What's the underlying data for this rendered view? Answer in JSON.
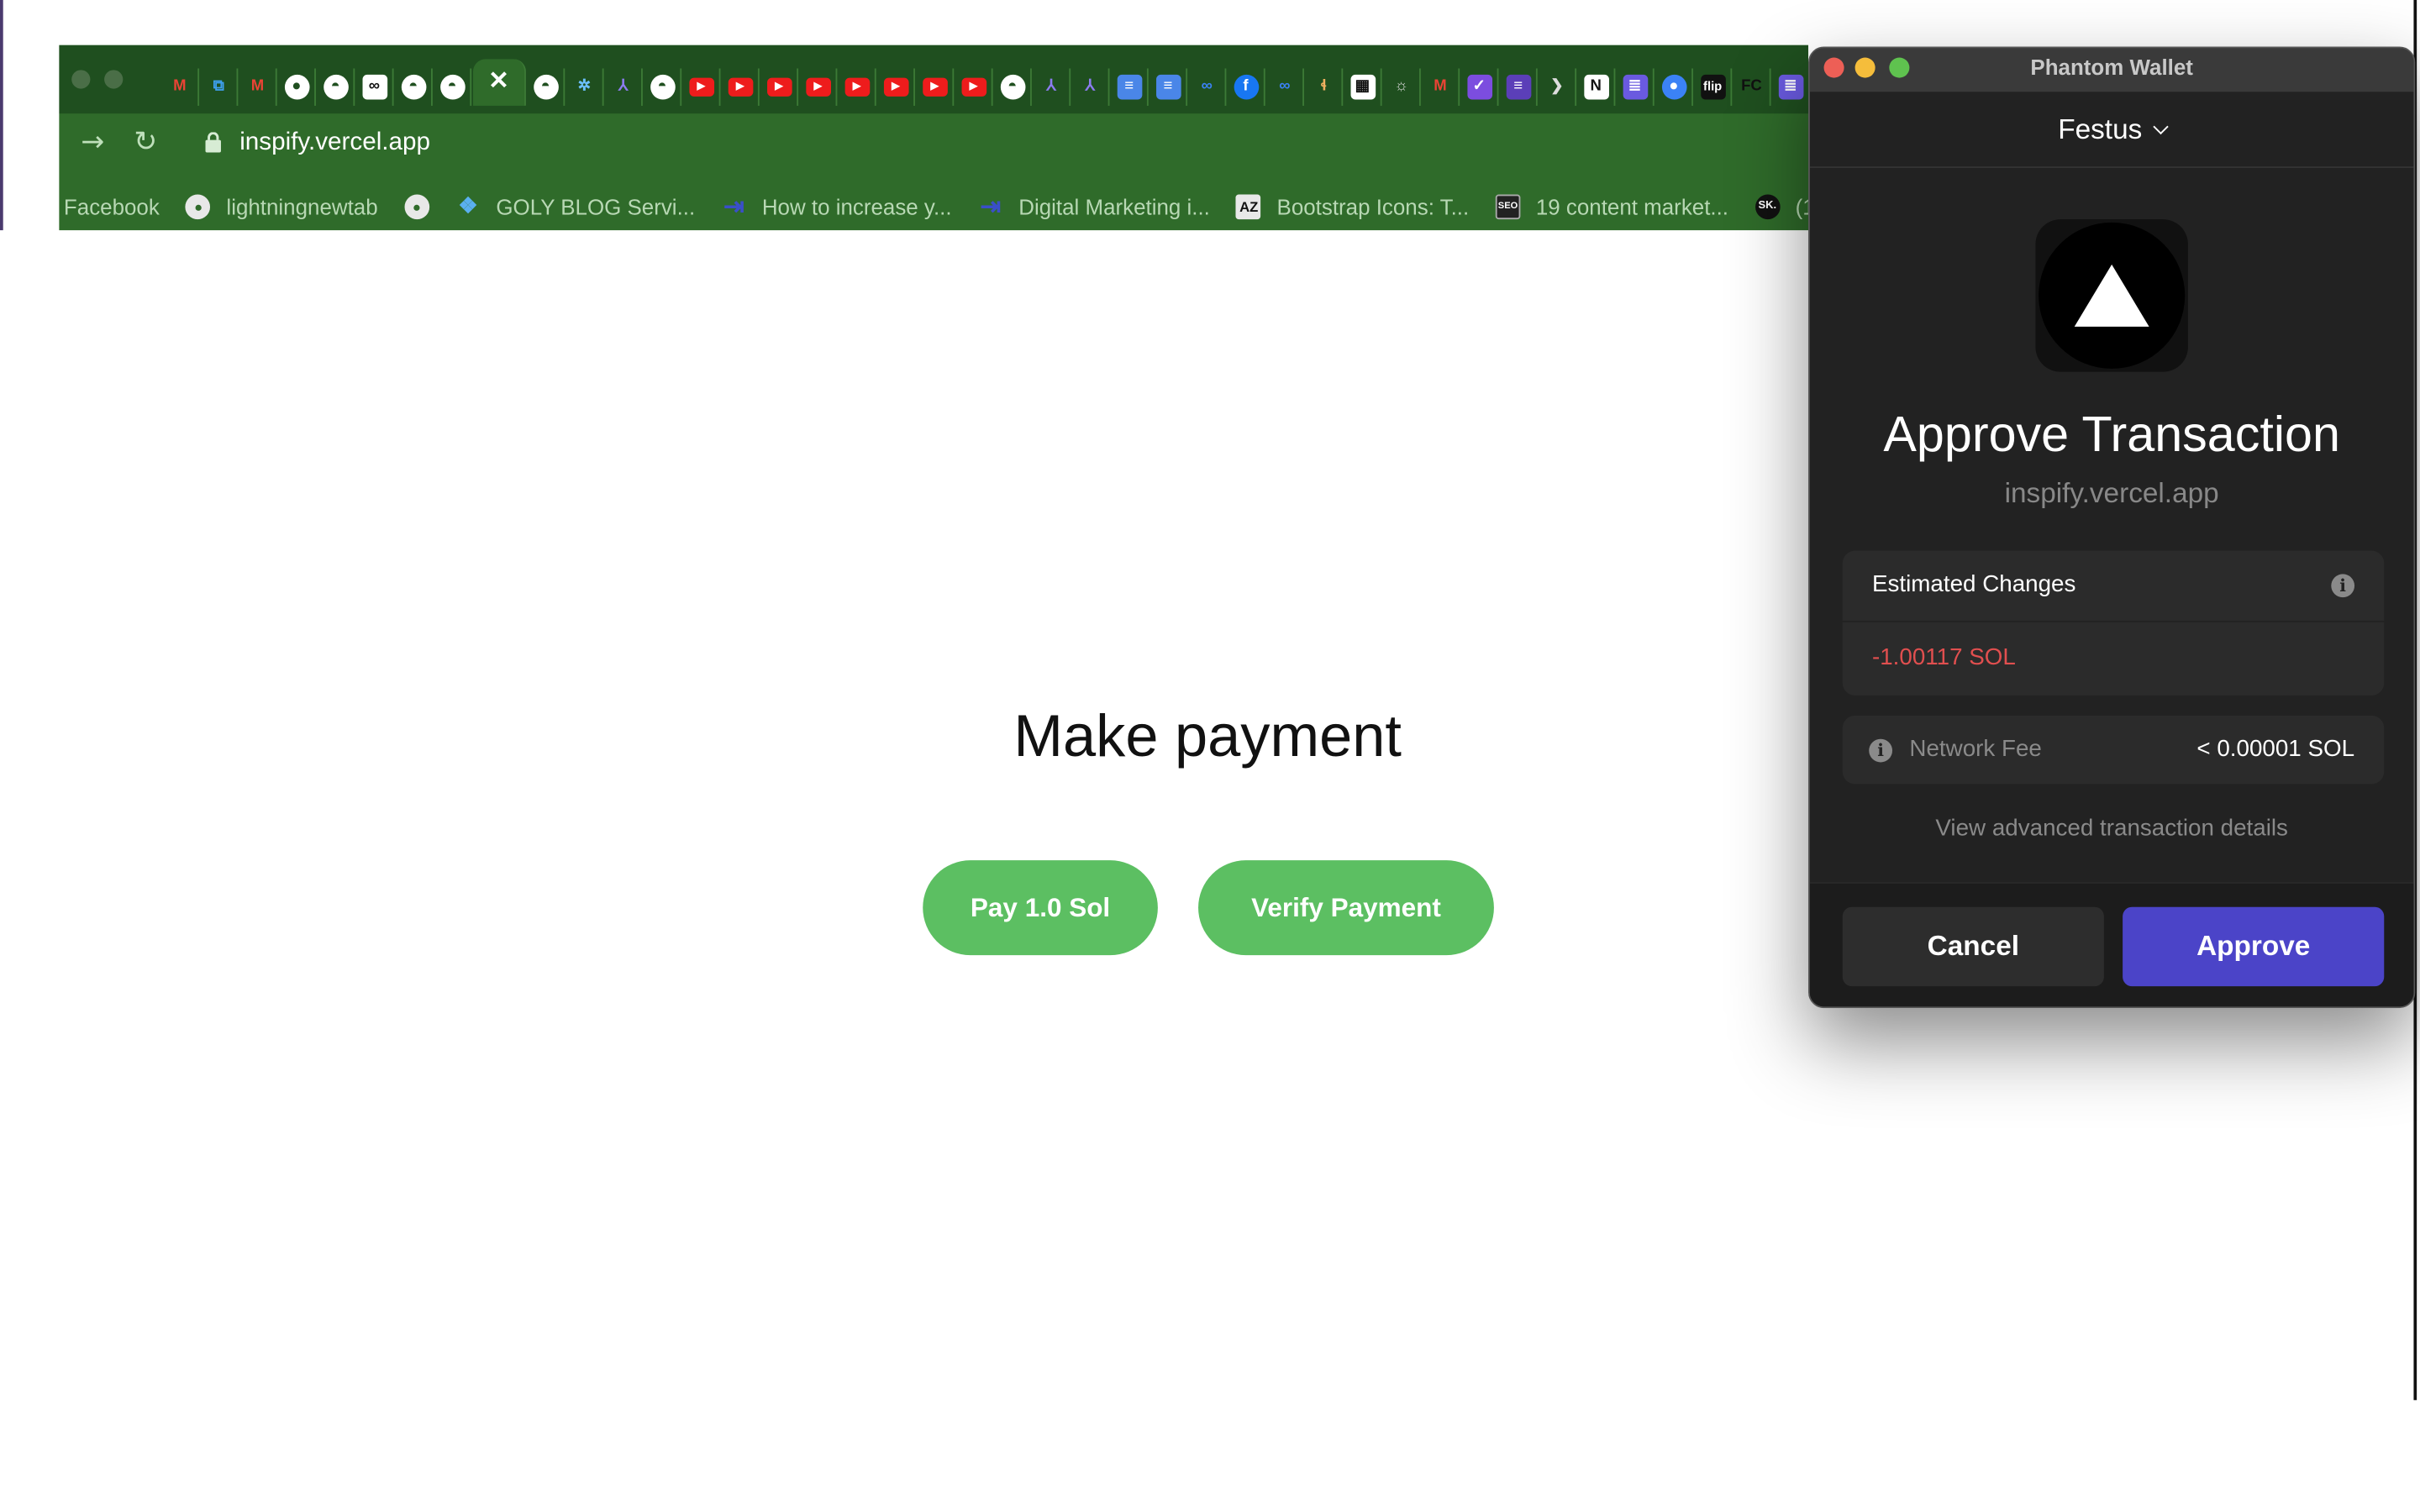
{
  "browser": {
    "url": "inspify.vercel.app",
    "bookmarks": [
      {
        "label": "Facebook",
        "icon": "facebook-icon",
        "color": "#2f6b2a"
      },
      {
        "label": "lightningnewtab",
        "icon": "globe-icon",
        "color": "#2f6b2a"
      },
      {
        "label": "",
        "icon": "globe-icon",
        "color": "#2f6b2a"
      },
      {
        "label": "GOLY BLOG Servi...",
        "icon": "goly-icon",
        "color": "#5ab0f0"
      },
      {
        "label": "How to increase y...",
        "icon": "arrow-logo-icon",
        "color": "#3a4fc8"
      },
      {
        "label": "Digital Marketing i...",
        "icon": "arrow-logo-icon",
        "color": "#3a4fc8"
      },
      {
        "label": "Bootstrap Icons: T...",
        "icon": "az-icon",
        "color": "#222222"
      },
      {
        "label": "19 content market...",
        "icon": "seo-icon",
        "color": "#222222"
      },
      {
        "label": "(1",
        "icon": "sk-icon",
        "color": "#111111"
      }
    ]
  },
  "page": {
    "heading": "Make payment",
    "pay_button": "Pay 1.0 Sol",
    "verify_button": "Verify Payment",
    "button_color": "#5cbf62"
  },
  "phantom": {
    "window_title": "Phantom Wallet",
    "account": "Festus",
    "heading": "Approve Transaction",
    "origin": "inspify.vercel.app",
    "estimated_changes_label": "Estimated Changes",
    "estimated_change_value": "-1.00117 SOL",
    "network_fee_label": "Network Fee",
    "network_fee_value": "< 0.00001 SOL",
    "advanced_link": "View advanced transaction details",
    "cancel_label": "Cancel",
    "approve_label": "Approve",
    "approve_color": "#4b44c8",
    "negative_color": "#e14f4f"
  }
}
